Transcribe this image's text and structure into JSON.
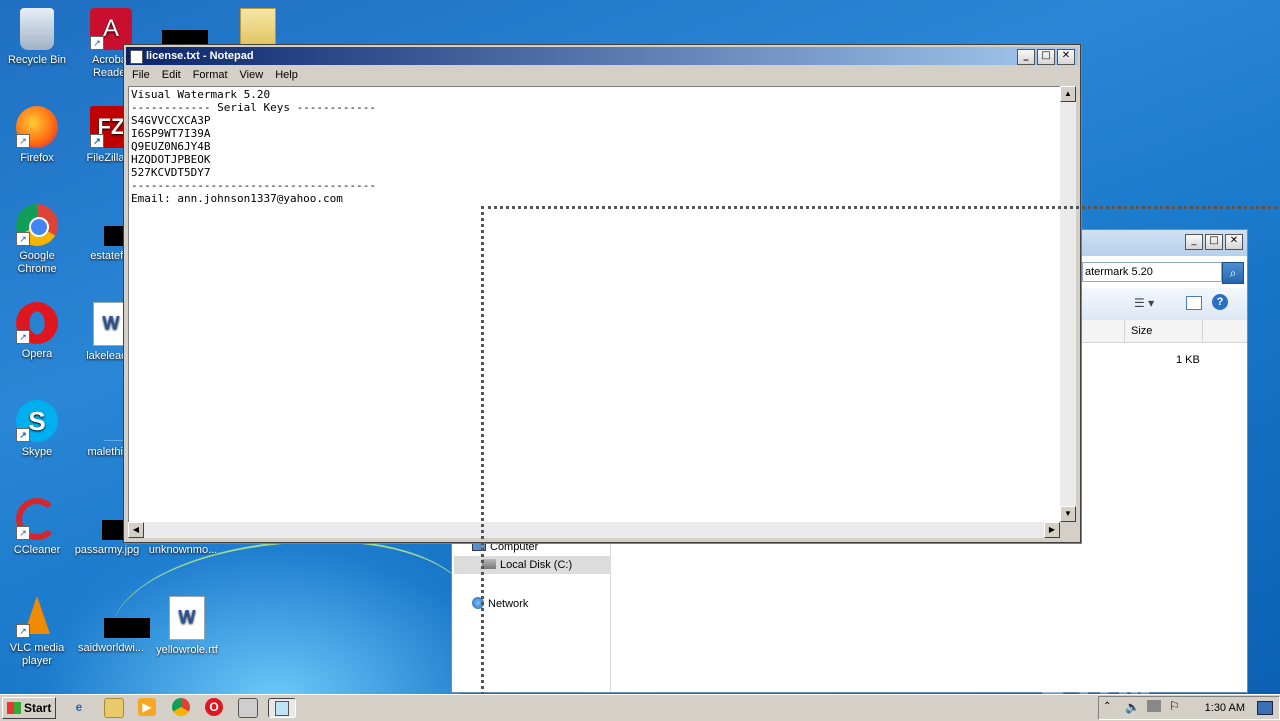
{
  "desktop": {
    "icons": [
      {
        "label": "Recycle Bin"
      },
      {
        "label": "Acrobat Reader"
      },
      {
        "label": "Firefox"
      },
      {
        "label": "FileZilla C"
      },
      {
        "label": "Google Chrome"
      },
      {
        "label": "estatefal"
      },
      {
        "label": "Opera"
      },
      {
        "label": "lakeleadin"
      },
      {
        "label": "Skype"
      },
      {
        "label": "malethink"
      },
      {
        "label": "CCleaner"
      },
      {
        "label": "passarmy.jpg"
      },
      {
        "label": "unknownmo..."
      },
      {
        "label": "VLC media player"
      },
      {
        "label": "saidworldwi..."
      },
      {
        "label": "yellowrole.rtf"
      }
    ]
  },
  "notepad": {
    "title": "license.txt - Notepad",
    "menu": [
      "File",
      "Edit",
      "Format",
      "View",
      "Help"
    ],
    "content": "Visual Watermark 5.20\n------------ Serial Keys ------------\nS4GVVCCXCA3P\nI6SP9WT7I39A\nQ9EUZ0N6JY4B\nHZQDOTJPBEOK\n527KCVDT5DY7\n-------------------------------------\nEmail: ann.johnson1337@yahoo.com"
  },
  "explorer": {
    "address_text": "atermark 5.20",
    "column_size": "Size",
    "file_size": "1 KB",
    "nav": {
      "computer": "Computer",
      "local_disk": "Local Disk (C:)",
      "network": "Network"
    }
  },
  "taskbar": {
    "start_label": "Start",
    "clock": "1:30 AM"
  },
  "watermark": "ANY RUN"
}
